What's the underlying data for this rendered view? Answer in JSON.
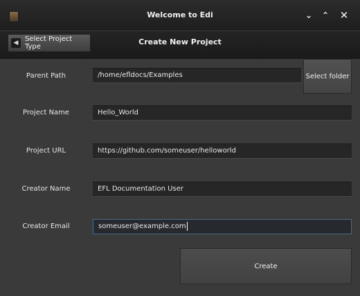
{
  "window": {
    "title": "Welcome to Edi",
    "minimize_icon": "chevron-down-icon",
    "maximize_icon": "chevron-up-icon",
    "close_icon": "close-icon"
  },
  "header": {
    "back_label": "Select Project Type",
    "title": "Create New Project"
  },
  "form": {
    "parent_path": {
      "label": "Parent Path",
      "value": "/home/efldocs/Examples"
    },
    "select_folder_label": "Select folder",
    "project_name": {
      "label": "Project Name",
      "value": "Hello_World"
    },
    "project_url": {
      "label": "Project URL",
      "value": "https://github.com/someuser/helloworld"
    },
    "creator_name": {
      "label": "Creator Name",
      "value": "EFL Documentation User"
    },
    "creator_email": {
      "label": "Creator Email",
      "value": "someuser@example.com"
    },
    "create_label": "Create"
  }
}
